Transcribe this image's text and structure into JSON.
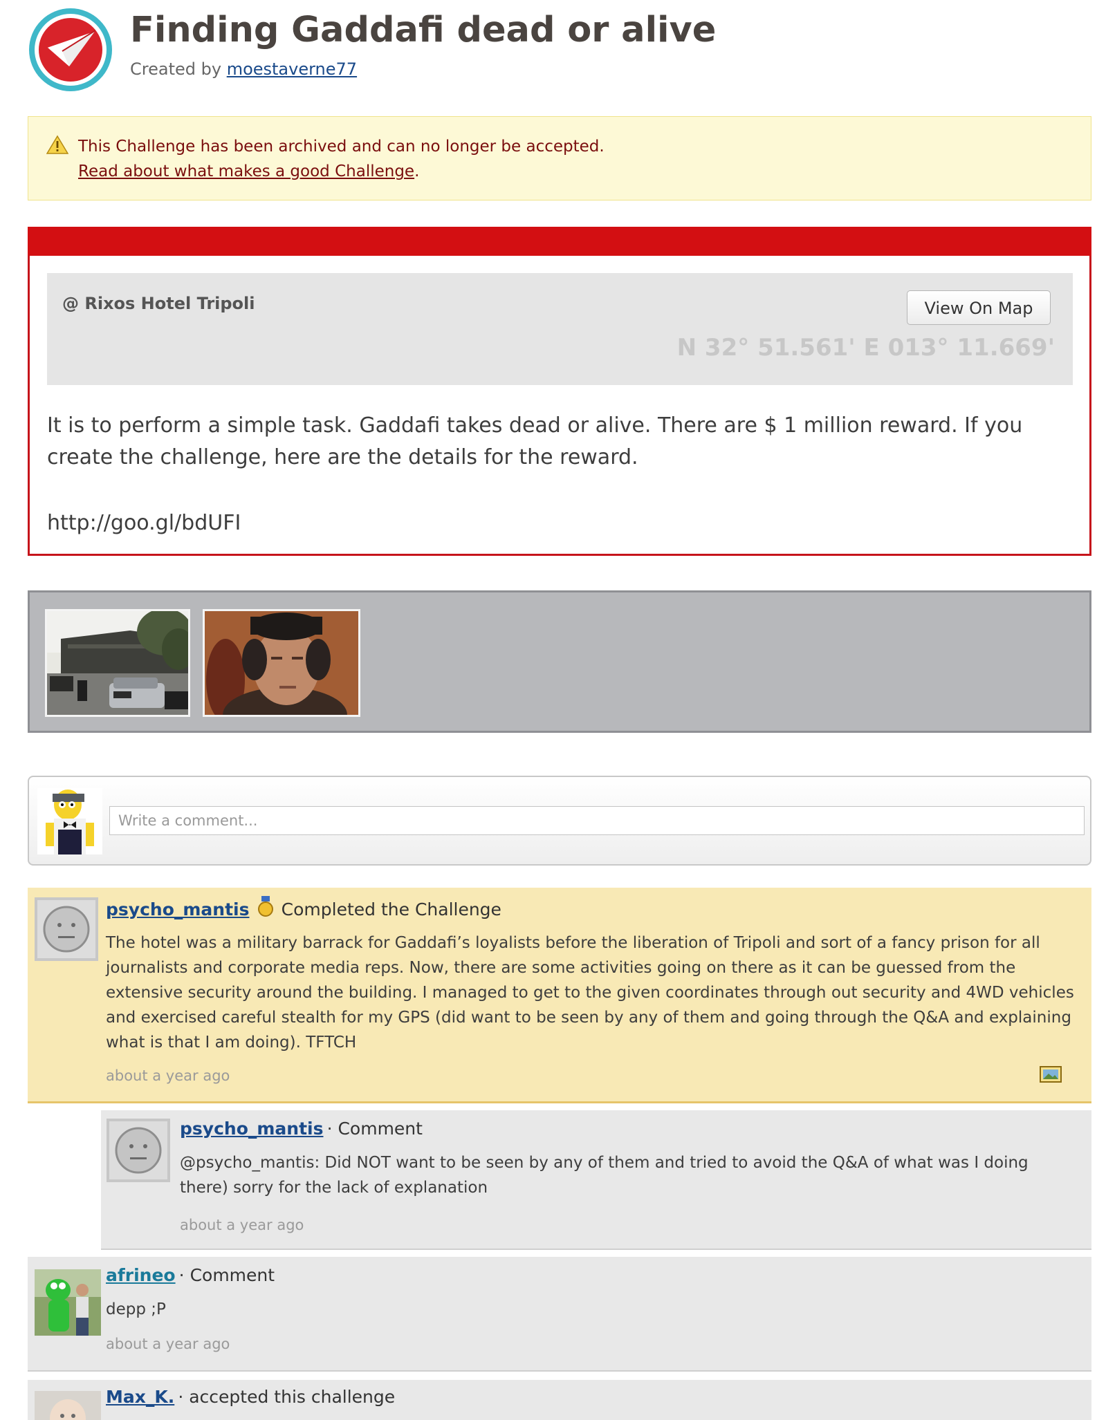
{
  "header": {
    "title": "Finding Gaddafi dead or alive",
    "created_by_prefix": "Created by",
    "creator": "moestaverne77",
    "logo_icon": "paper-plane-icon"
  },
  "notice": {
    "icon": "warning-icon",
    "message": "This Challenge has been archived and can no longer be accepted.",
    "link": "Read about what makes a good Challenge",
    "link_suffix": "."
  },
  "challenge": {
    "location": "@ Rixos Hotel Tripoli",
    "view_map_label": "View On Map",
    "coordinates": "N 32° 51.561' E 013° 11.669'",
    "description": "It is to perform a simple task. Gaddafi takes dead or alive. There are $ 1 million reward. If you create the challenge, here are the details for the reward.",
    "url": "http://goo.gl/bdUFI"
  },
  "photos": [
    {
      "name": "hotel-street-photo"
    },
    {
      "name": "gaddafi-portrait-photo"
    }
  ],
  "comment_box": {
    "placeholder": "Write a comment..."
  },
  "activity": [
    {
      "user": "psycho_mantis",
      "badge_icon": "medal-icon",
      "action": "Completed the Challenge",
      "text": "The hotel was a military barrack for Gaddafi’s loyalists before the liberation of Tripoli and sort of a fancy prison for all journalists and corporate media reps. Now, there are some activities going on there as it can be guessed from the extensive security around the building. I managed to get to the given coordinates through out security and 4WD vehicles and exercised careful stealth for my GPS (did want to be seen by any of them and going through the Q&A and explaining what is that I am doing). TFTCH",
      "time": "about a year ago",
      "attachment_icon": "image-icon"
    },
    {
      "user": "psycho_mantis",
      "action": "· Comment",
      "text": "@psycho_mantis: Did NOT want to be seen by any of them and tried to avoid the Q&A of what was I doing there) sorry for the lack of explanation",
      "time": "about a year ago"
    },
    {
      "user": "afrineo",
      "action": "· Comment",
      "text": "depp ;P",
      "time": "about a year ago"
    },
    {
      "user": "Max_K.",
      "action": "· accepted this challenge"
    }
  ],
  "colors": {
    "brand_red": "#d30f12",
    "notice_bg": "#fdf9d6",
    "completed_bg": "#f8e9b5",
    "link": "#1a4a8a"
  }
}
